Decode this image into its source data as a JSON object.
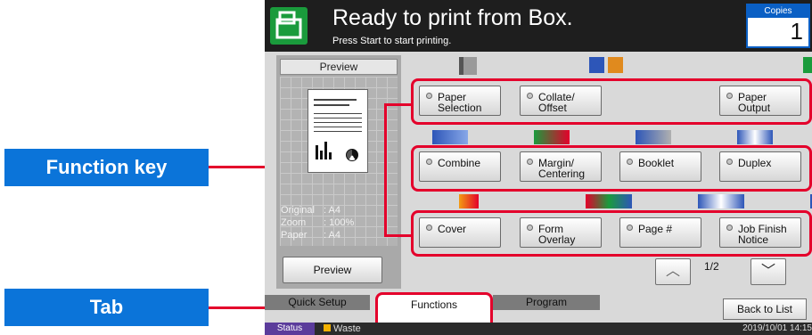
{
  "callouts": {
    "function_key": "Function key",
    "tab": "Tab"
  },
  "header": {
    "title": "Ready to print from Box.",
    "subtitle": "Press Start to start printing.",
    "copies_label": "Copies",
    "copies_value": "1"
  },
  "preview": {
    "title": "Preview",
    "info": [
      {
        "key": "Original",
        "value": ": A4"
      },
      {
        "key": "Zoom",
        "value": ": 100%"
      },
      {
        "key": "Paper",
        "value": ": A4"
      }
    ],
    "button": "Preview"
  },
  "functions": {
    "row1": [
      "Paper Selection",
      "Collate/ Offset",
      "Paper Output"
    ],
    "row2": [
      "Combine",
      "Margin/ Centering",
      "Booklet",
      "Duplex"
    ],
    "row3": [
      "Cover",
      "Form Overlay",
      "Page #",
      "Job Finish Notice"
    ]
  },
  "pager": {
    "text": "1/2",
    "up": "︿",
    "down": "﹀"
  },
  "tabs": {
    "quick_setup": "Quick Setup",
    "functions": "Functions",
    "program": "Program"
  },
  "back_button": "Back to List",
  "status": {
    "label": "Status",
    "waste": "Waste",
    "datetime": "2019/10/01 14:15"
  },
  "colors": {
    "callout": "#0b74d9",
    "highlight": "#e4002b",
    "header": "#1e1e1e",
    "brand_green": "#1a9b3c"
  }
}
